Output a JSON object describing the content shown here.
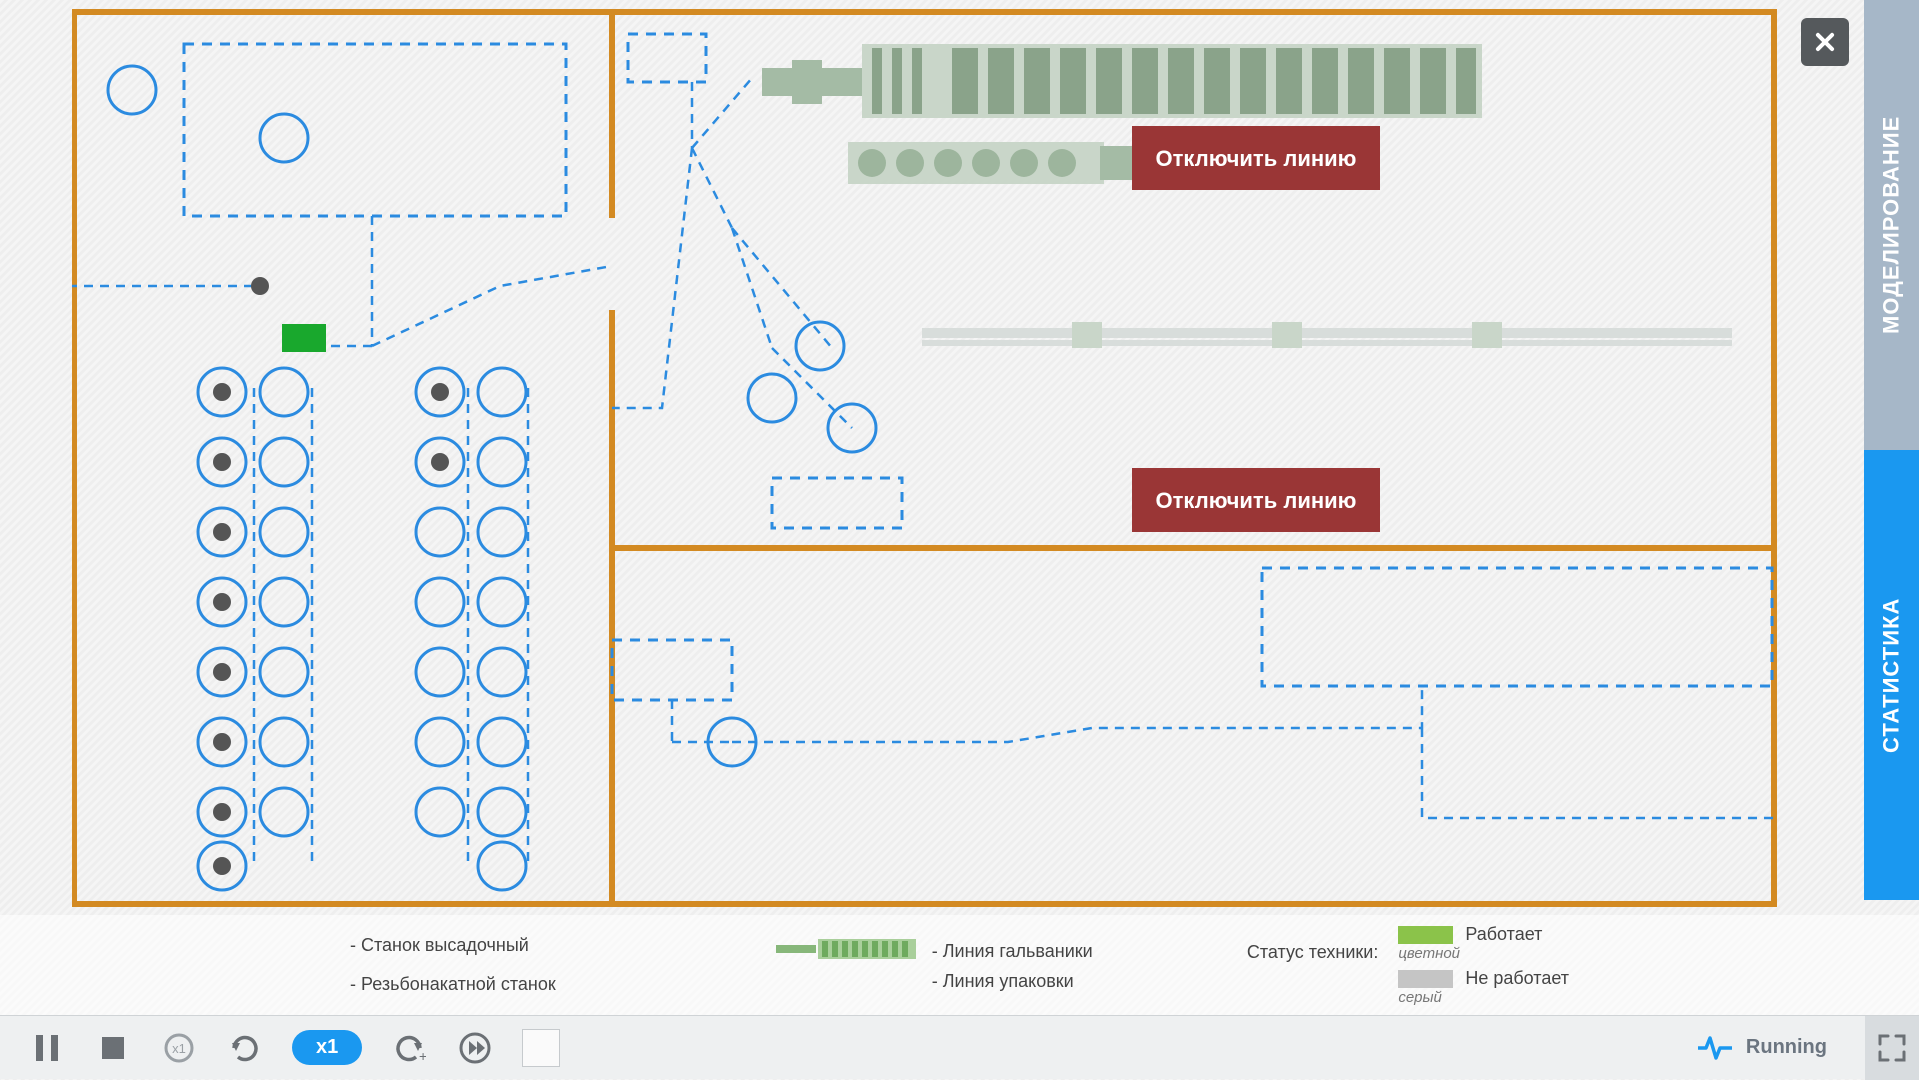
{
  "sideTabs": {
    "model": "МОДЕЛИРОВАНИЕ",
    "stats": "СТАТИСТИКА"
  },
  "buttons": {
    "disableLine1": "Отключить линию",
    "disableLine2": "Отключить линию"
  },
  "legend": {
    "col1_item1": "- Станок высадочный",
    "col1_item2": "- Резьбонакатной станок",
    "col2_item1": "- Линия гальваники",
    "col2_item2": "- Линия упаковки",
    "status_label": "Статус техники:",
    "status_working": "Работает",
    "status_working_sub": "цветной",
    "status_notworking": "Не работает",
    "status_notworking_sub": "серый"
  },
  "toolbar": {
    "speed_text": "x1",
    "slow_text": "x1",
    "running": "Running"
  }
}
